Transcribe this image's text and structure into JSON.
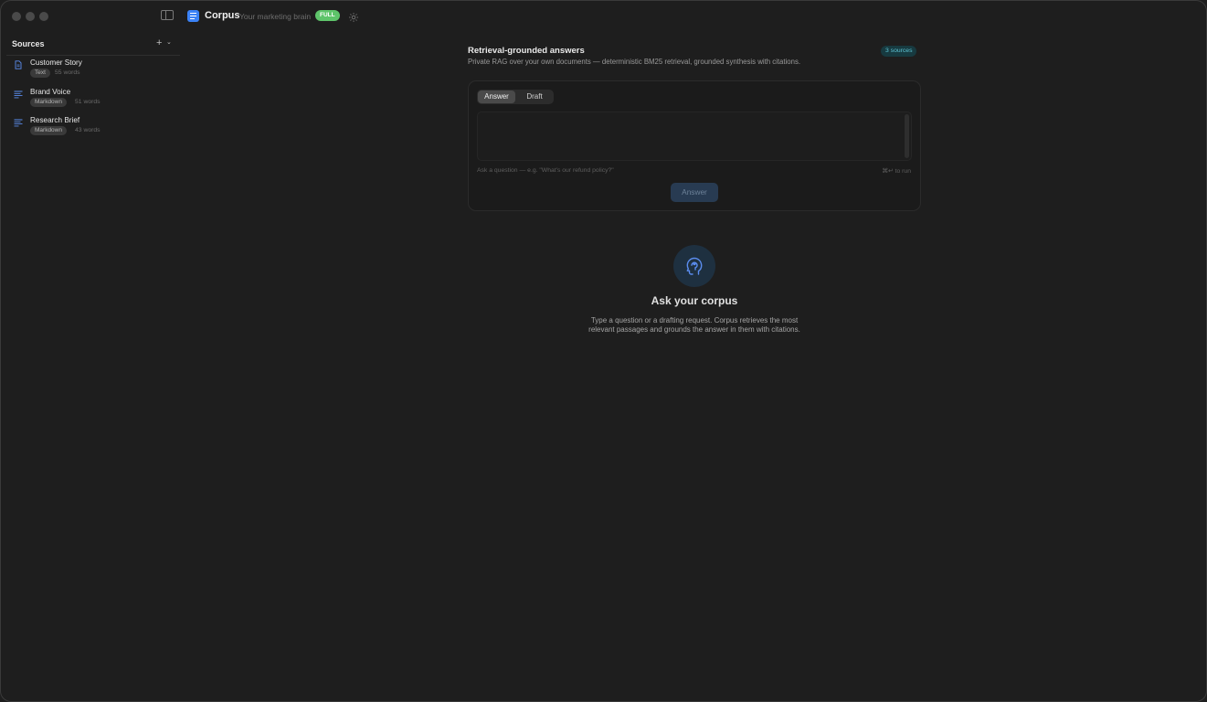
{
  "titlebar": {
    "app_name": "Corpus",
    "app_subtitle": "Your marketing brain",
    "plan_badge": "FULL",
    "accent_color": "#3b82f6",
    "badge_color": "#5ec46a"
  },
  "sidebar": {
    "title": "Sources",
    "add_label": "+",
    "items": [
      {
        "name": "Customer Story",
        "type": "Text",
        "words": "55 words",
        "icon": "document-icon"
      },
      {
        "name": "Brand Voice",
        "type": "Markdown",
        "words": "51 words",
        "icon": "lines-icon"
      },
      {
        "name": "Research Brief",
        "type": "Markdown",
        "words": "43 words",
        "icon": "lines-icon"
      }
    ]
  },
  "main": {
    "title": "Retrieval-grounded answers",
    "subtitle": "Private RAG over your own documents — deterministic BM25 retrieval, grounded synthesis with citations.",
    "sources_badge": "3 sources",
    "tabs": [
      {
        "label": "Answer",
        "active": true
      },
      {
        "label": "Draft",
        "active": false
      }
    ],
    "input_hint": "Ask a question — e.g. \"What's our refund policy?\"",
    "shortcut_hint": "⌘↵ to run",
    "submit_label": "Answer",
    "empty_state": {
      "icon": "head-icon",
      "title": "Ask your corpus",
      "description": "Type a question or a drafting request. Corpus retrieves the most relevant passages and grounds the answer in them with citations."
    }
  }
}
